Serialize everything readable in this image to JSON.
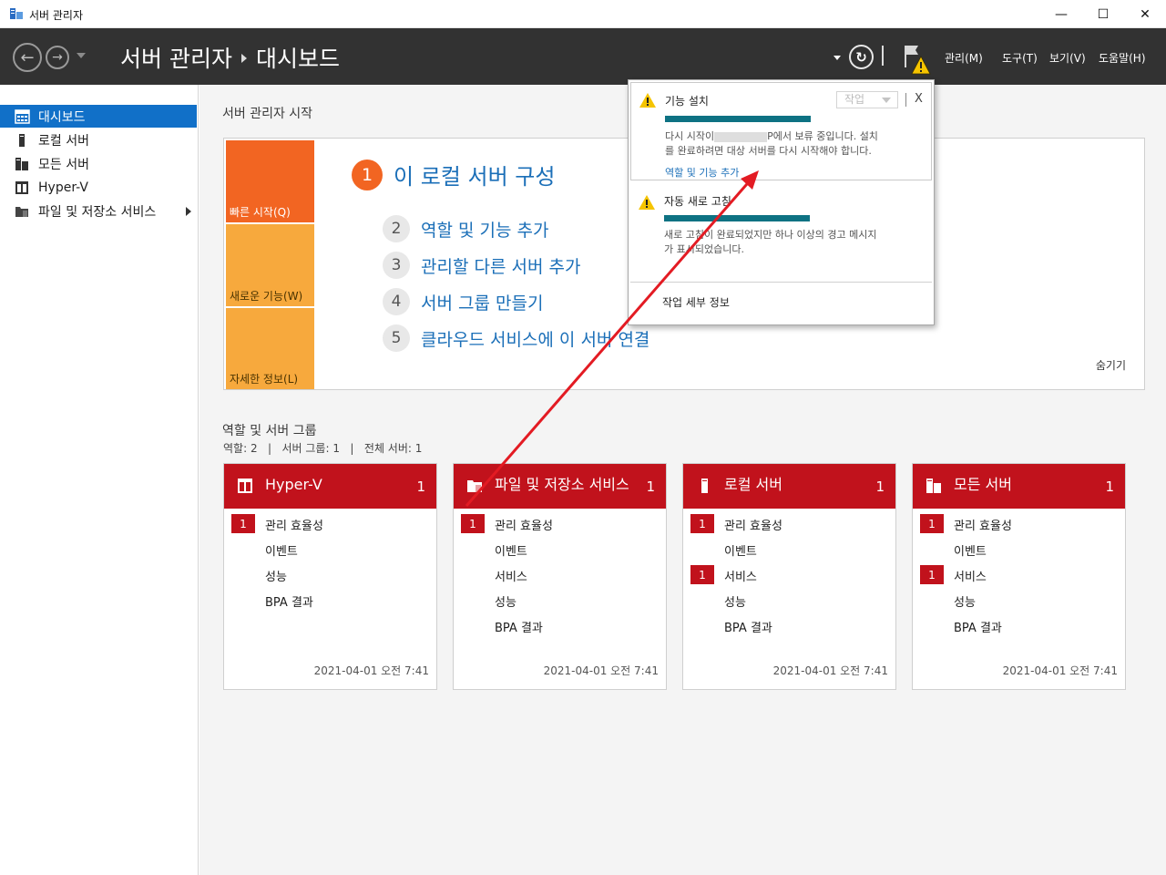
{
  "window": {
    "title": "서버 관리자",
    "minimize": "—",
    "maximize": "☐",
    "close": "✕"
  },
  "header": {
    "breadcrumb_root": "서버 관리자",
    "breadcrumb_page": "대시보드",
    "menus": [
      "관리(M)",
      "도구(T)",
      "보기(V)",
      "도움말(H)"
    ]
  },
  "sidebar": {
    "items": [
      {
        "label": "대시보드",
        "icon": "dashboard-icon"
      },
      {
        "label": "로컬 서버",
        "icon": "server-icon"
      },
      {
        "label": "모든 서버",
        "icon": "servers-icon"
      },
      {
        "label": "Hyper-V",
        "icon": "hyperv-icon"
      },
      {
        "label": "파일 및 저장소 서비스",
        "icon": "folder-icon"
      }
    ]
  },
  "welcome": {
    "title": "서버 관리자 시작",
    "tiles": [
      "빠른 시작(Q)",
      "새로운 기능(W)",
      "자세한 정보(L)"
    ],
    "main_step": {
      "num": "1",
      "label": "이 로컬 서버 구성"
    },
    "steps": [
      {
        "num": "2",
        "label": "역할 및 기능 추가"
      },
      {
        "num": "3",
        "label": "관리할 다른 서버 추가"
      },
      {
        "num": "4",
        "label": "서버 그룹 만들기"
      },
      {
        "num": "5",
        "label": "클라우드 서비스에 이 서버 연결"
      }
    ],
    "hide": "숨기기"
  },
  "roles": {
    "title": "역할 및 서버 그룹",
    "counts": "역할: 2   |   서버 그룹: 1   |   전체 서버: 1",
    "cards": [
      {
        "name": "Hyper-V",
        "count": "1",
        "rows": [
          {
            "label": "관리 효율성",
            "badge": "1"
          },
          {
            "label": "이벤트",
            "badge": ""
          },
          {
            "label": "성능",
            "badge": ""
          },
          {
            "label": "BPA 결과",
            "badge": ""
          }
        ],
        "time": "2021-04-01 오전 7:41"
      },
      {
        "name": "파일 및 저장소 서비스",
        "count": "1",
        "rows": [
          {
            "label": "관리 효율성",
            "badge": "1"
          },
          {
            "label": "이벤트",
            "badge": ""
          },
          {
            "label": "서비스",
            "badge": ""
          },
          {
            "label": "성능",
            "badge": ""
          },
          {
            "label": "BPA 결과",
            "badge": ""
          }
        ],
        "time": "2021-04-01 오전 7:41"
      },
      {
        "name": "로컬 서버",
        "count": "1",
        "rows": [
          {
            "label": "관리 효율성",
            "badge": "1"
          },
          {
            "label": "이벤트",
            "badge": ""
          },
          {
            "label": "서비스",
            "badge": "1"
          },
          {
            "label": "성능",
            "badge": ""
          },
          {
            "label": "BPA 결과",
            "badge": ""
          }
        ],
        "time": "2021-04-01 오전 7:41"
      },
      {
        "name": "모든 서버",
        "count": "1",
        "rows": [
          {
            "label": "관리 효율성",
            "badge": "1"
          },
          {
            "label": "이벤트",
            "badge": ""
          },
          {
            "label": "서비스",
            "badge": "1"
          },
          {
            "label": "성능",
            "badge": ""
          },
          {
            "label": "BPA 결과",
            "badge": ""
          }
        ],
        "time": "2021-04-01 오전 7:41"
      }
    ]
  },
  "notifications": {
    "items": [
      {
        "title": "기능 설치",
        "text_a": "다시 시작이",
        "text_b": "P에서 보류 중입니다. 설치",
        "text_c": "를 완료하려면 대상 서버를 다시 시작해야 합니다.",
        "link": "역할 및 기능 추가"
      },
      {
        "title": "자동 새로 고침",
        "text_a": "새로 고침이 완료되었지만 하나 이상의 경고 메시지",
        "text_b": "가 표시되었습니다."
      }
    ],
    "task_dropdown": "작업",
    "close": "X",
    "task_details": "작업 세부 정보"
  },
  "colors": {
    "header_bg": "#323232",
    "accent_blue": "#1170c8",
    "tile_orange": "#f26522",
    "tile_amber": "#f7a93d",
    "card_red": "#c1121c",
    "progress_teal": "#0e7283",
    "annotation_arrow": "#e31b23"
  }
}
